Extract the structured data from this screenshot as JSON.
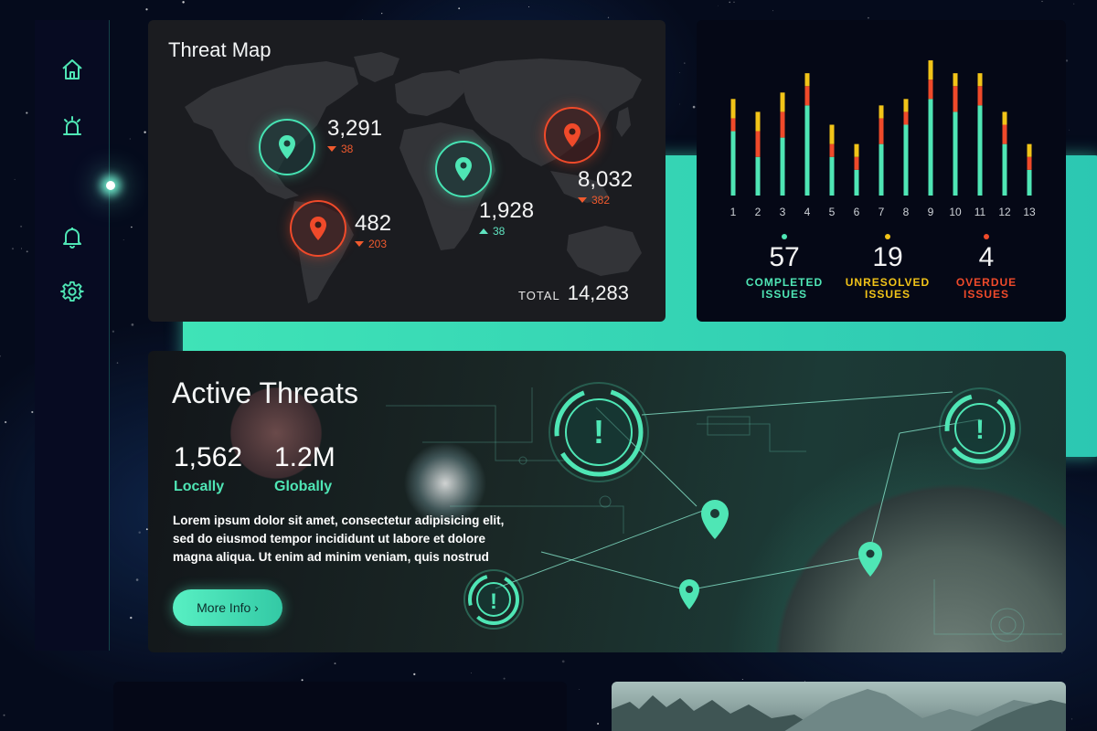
{
  "sidebar": {
    "items": [
      {
        "icon": "home-icon",
        "active": false
      },
      {
        "icon": "alarm-icon",
        "active": false
      },
      {
        "icon": "pie-chart-icon",
        "active": true
      },
      {
        "icon": "bell-icon",
        "active": false
      },
      {
        "icon": "gear-icon",
        "active": false
      }
    ]
  },
  "threat_map": {
    "title": "Threat Map",
    "regions": [
      {
        "value": "3,291",
        "delta": "38",
        "direction": "down"
      },
      {
        "value": "482",
        "delta": "203",
        "direction": "down"
      },
      {
        "value": "1,928",
        "delta": "38",
        "direction": "up"
      },
      {
        "value": "8,032",
        "delta": "382",
        "direction": "down"
      }
    ],
    "total_label": "TOTAL",
    "total_value": "14,283"
  },
  "issues": {
    "completed": {
      "value": "57",
      "label_1": "COMPLETED",
      "label_2": "ISSUES",
      "color": "#4fe6b5"
    },
    "unresolved": {
      "value": "19",
      "label_1": "UNRESOLVED",
      "label_2": "ISSUES",
      "color": "#f2c418"
    },
    "overdue": {
      "value": "4",
      "label_1": "OVERDUE",
      "label_2": "ISSUES",
      "color": "#f04a2a"
    }
  },
  "chart_data": {
    "type": "bar",
    "stacked": true,
    "categories": [
      "1",
      "2",
      "3",
      "4",
      "5",
      "6",
      "7",
      "8",
      "9",
      "10",
      "11",
      "12",
      "13"
    ],
    "series": [
      {
        "values": [
          10,
          6,
          9,
          14,
          6,
          4,
          8,
          11,
          15,
          13,
          14,
          8,
          4
        ],
        "color": "#4fe6b5"
      },
      {
        "values": [
          2,
          4,
          4,
          3,
          2,
          2,
          4,
          2,
          3,
          4,
          3,
          3,
          2
        ],
        "color": "#f04a2a"
      },
      {
        "values": [
          3,
          3,
          3,
          2,
          3,
          2,
          2,
          2,
          3,
          2,
          2,
          2,
          2
        ],
        "color": "#f2c418"
      }
    ],
    "ylim": [
      0,
      22
    ]
  },
  "active_threats": {
    "title": "Active Threats",
    "local": {
      "value": "1,562",
      "label": "Locally"
    },
    "global": {
      "value": "1.2M",
      "label": "Globally"
    },
    "description": "Lorem ipsum dolor sit amet, consectetur adipisicing elit, sed do eiusmod tempor incididunt ut labore et dolore magna aliqua. Ut enim ad minim veniam, quis nostrud",
    "button_label": "More Info ›"
  }
}
